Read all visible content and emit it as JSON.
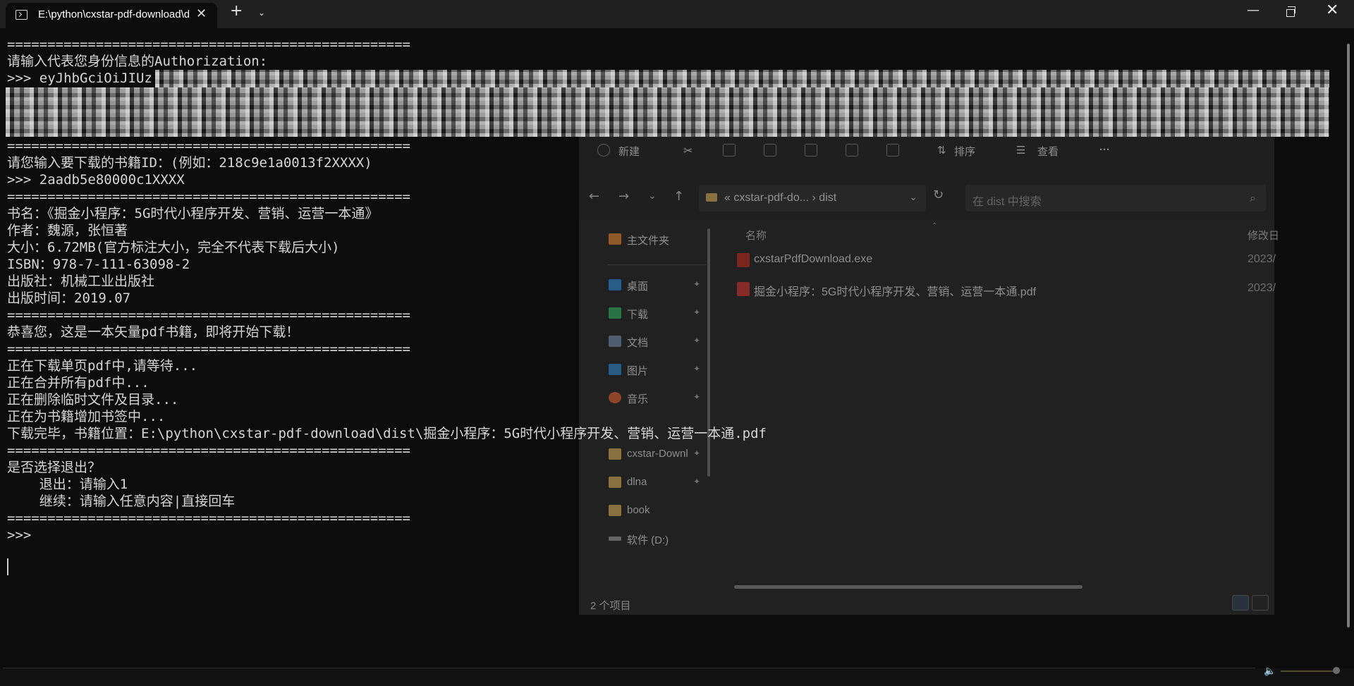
{
  "titlebar": {
    "tab_title": "E:\\python\\cxstar-pdf-download\\dist\\cxstarPdfDownload.exe",
    "close_glyph": "✕",
    "newtab_glyph": "+",
    "dropdown_glyph": "⌄",
    "minimize_glyph": "—",
    "closewin_glyph": "✕"
  },
  "terminal": {
    "lines": [
      "==================================================",
      "请输入代表您身份信息的Authorization:",
      ">>> eyJhbGciOiJIUz",
      "",
      "",
      "",
      "==================================================",
      "请您输入要下载的书籍ID：(例如：218c9e1a0013f2XXXX)",
      ">>> 2aadb5e80000c1XXXX",
      "==================================================",
      "书名：《掘金小程序：5G时代小程序开发、营销、运营一本通》",
      "作者：魏源，张恒著",
      "大小：6.72MB(官方标注大小，完全不代表下载后大小)",
      "ISBN：978-7-111-63098-2",
      "出版社：机械工业出版社",
      "出版时间：2019.07",
      "==================================================",
      "恭喜您，这是一本矢量pdf书籍，即将开始下载！",
      "==================================================",
      "正在下载单页pdf中,请等待...",
      "正在合并所有pdf中...",
      "正在删除临时文件及目录...",
      "正在为书籍增加书签中...",
      "下载完毕，书籍位置：E:\\python\\cxstar-pdf-download\\dist\\掘金小程序：5G时代小程序开发、营销、运营一本通.pdf",
      "==================================================",
      "是否选择退出？",
      "    退出：请输入1",
      "    继续：请输入任意内容|直接回车",
      "==================================================",
      ">>>"
    ]
  },
  "explorer": {
    "toolbar": {
      "new_label": "新建",
      "sort_label": "排序",
      "view_label": "查看",
      "more_glyph": "···"
    },
    "nav": {
      "back": "←",
      "forward": "→",
      "recent": "⌄",
      "up": "↑",
      "refresh": "↻"
    },
    "address": {
      "segments": "«  cxstar-pdf-do...  ›  dist",
      "dropdown": "⌄"
    },
    "search": {
      "placeholder": "在 dist 中搜索",
      "icon": "⌕"
    },
    "sidebar": {
      "home": "主文件夹",
      "items": [
        {
          "label": "桌面",
          "color": "#3a8fd8"
        },
        {
          "label": "下载",
          "color": "#3bb36a"
        },
        {
          "label": "文档",
          "color": "#7a8fb0"
        },
        {
          "label": "图片",
          "color": "#3b8ed0"
        },
        {
          "label": "音乐",
          "color": "#e06a3a"
        },
        {
          "label": "cxstar-Downl",
          "color": "#d6b160"
        },
        {
          "label": "dlna",
          "color": "#d6b160"
        },
        {
          "label": "book",
          "color": "#d6b160"
        },
        {
          "label": "软件 (D:)",
          "color": "#9a9a9a"
        }
      ],
      "pin_glyph": "📌"
    },
    "list": {
      "col_name": "名称",
      "col_modified": "修改日",
      "files": [
        {
          "name": "cxstarPdfDownload.exe",
          "date": "2023/",
          "icon_color": "#c0392b"
        },
        {
          "name": "掘金小程序：5G时代小程序开发、营销、运营一本通.pdf",
          "date": "2023/",
          "icon_color": "#d0403a"
        }
      ]
    },
    "status": "2 个项目"
  },
  "colors": {
    "terminal_bg": "#0c0c0c",
    "titlebar_bg": "#202020",
    "text": "#cccccc"
  }
}
